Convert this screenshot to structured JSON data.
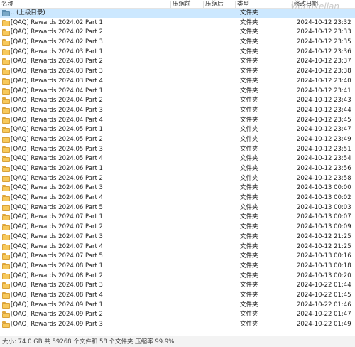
{
  "watermark": "wongkellan",
  "columns": {
    "name": "名称",
    "packed": "压缩前",
    "compressed": "压缩后",
    "type": "类型",
    "modified": "修改日期"
  },
  "parent_row": {
    "name": ".. (上级目录)",
    "type": "文件夹",
    "icon": "folder-up-icon"
  },
  "rows": [
    {
      "name": "[QAQ] Rewards 2024.02 Part 1",
      "type": "文件夹",
      "date": "2024-10-12 23:32",
      "icon": "folder-icon"
    },
    {
      "name": "[QAQ] Rewards 2024.02 Part 2",
      "type": "文件夹",
      "date": "2024-10-12 23:33",
      "icon": "folder-icon"
    },
    {
      "name": "[QAQ] Rewards 2024.02 Part 3",
      "type": "文件夹",
      "date": "2024-10-12 23:35",
      "icon": "folder-icon"
    },
    {
      "name": "[QAQ] Rewards 2024.03 Part 1",
      "type": "文件夹",
      "date": "2024-10-12 23:36",
      "icon": "folder-icon"
    },
    {
      "name": "[QAQ] Rewards 2024.03 Part 2",
      "type": "文件夹",
      "date": "2024-10-12 23:37",
      "icon": "folder-icon"
    },
    {
      "name": "[QAQ] Rewards 2024.03 Part 3",
      "type": "文件夹",
      "date": "2024-10-12 23:38",
      "icon": "folder-icon"
    },
    {
      "name": "[QAQ] Rewards 2024.03 Part 4",
      "type": "文件夹",
      "date": "2024-10-12 23:40",
      "icon": "folder-icon"
    },
    {
      "name": "[QAQ] Rewards 2024.04 Part 1",
      "type": "文件夹",
      "date": "2024-10-12 23:41",
      "icon": "folder-icon"
    },
    {
      "name": "[QAQ] Rewards 2024.04 Part 2",
      "type": "文件夹",
      "date": "2024-10-12 23:43",
      "icon": "folder-icon"
    },
    {
      "name": "[QAQ] Rewards 2024.04 Part 3",
      "type": "文件夹",
      "date": "2024-10-12 23:44",
      "icon": "folder-icon"
    },
    {
      "name": "[QAQ] Rewards 2024.04 Part 4",
      "type": "文件夹",
      "date": "2024-10-12 23:45",
      "icon": "folder-icon"
    },
    {
      "name": "[QAQ] Rewards 2024.05 Part 1",
      "type": "文件夹",
      "date": "2024-10-12 23:47",
      "icon": "folder-icon"
    },
    {
      "name": "[QAQ] Rewards 2024.05 Part 2",
      "type": "文件夹",
      "date": "2024-10-12 23:49",
      "icon": "folder-icon"
    },
    {
      "name": "[QAQ] Rewards 2024.05 Part 3",
      "type": "文件夹",
      "date": "2024-10-12 23:51",
      "icon": "folder-icon"
    },
    {
      "name": "[QAQ] Rewards 2024.05 Part 4",
      "type": "文件夹",
      "date": "2024-10-12 23:54",
      "icon": "folder-icon"
    },
    {
      "name": "[QAQ] Rewards 2024.06 Part 1",
      "type": "文件夹",
      "date": "2024-10-12 23:56",
      "icon": "folder-icon"
    },
    {
      "name": "[QAQ] Rewards 2024.06 Part 2",
      "type": "文件夹",
      "date": "2024-10-12 23:58",
      "icon": "folder-icon"
    },
    {
      "name": "[QAQ] Rewards 2024.06 Part 3",
      "type": "文件夹",
      "date": "2024-10-13 00:00",
      "icon": "folder-icon"
    },
    {
      "name": "[QAQ] Rewards 2024.06 Part 4",
      "type": "文件夹",
      "date": "2024-10-13 00:02",
      "icon": "folder-icon"
    },
    {
      "name": "[QAQ] Rewards 2024.06 Part 5",
      "type": "文件夹",
      "date": "2024-10-13 00:03",
      "icon": "folder-icon"
    },
    {
      "name": "[QAQ] Rewards 2024.07 Part 1",
      "type": "文件夹",
      "date": "2024-10-13 00:07",
      "icon": "folder-icon"
    },
    {
      "name": "[QAQ] Rewards 2024.07 Part 2",
      "type": "文件夹",
      "date": "2024-10-13 00:09",
      "icon": "folder-icon"
    },
    {
      "name": "[QAQ] Rewards 2024.07 Part 3",
      "type": "文件夹",
      "date": "2024-10-12 21:25",
      "icon": "folder-icon"
    },
    {
      "name": "[QAQ] Rewards 2024.07 Part 4",
      "type": "文件夹",
      "date": "2024-10-12 21:25",
      "icon": "folder-icon"
    },
    {
      "name": "[QAQ] Rewards 2024.07 Part 5",
      "type": "文件夹",
      "date": "2024-10-13 00:16",
      "icon": "folder-icon"
    },
    {
      "name": "[QAQ] Rewards 2024.08 Part 1",
      "type": "文件夹",
      "date": "2024-10-13 00:18",
      "icon": "folder-icon"
    },
    {
      "name": "[QAQ] Rewards 2024.08 Part 2",
      "type": "文件夹",
      "date": "2024-10-13 00:20",
      "icon": "folder-icon"
    },
    {
      "name": "[QAQ] Rewards 2024.08 Part 3",
      "type": "文件夹",
      "date": "2024-10-22 01:44",
      "icon": "folder-icon"
    },
    {
      "name": "[QAQ] Rewards 2024.08 Part 4",
      "type": "文件夹",
      "date": "2024-10-22 01:45",
      "icon": "folder-icon"
    },
    {
      "name": "[QAQ] Rewards 2024.09 Part 1",
      "type": "文件夹",
      "date": "2024-10-22 01:46",
      "icon": "folder-icon"
    },
    {
      "name": "[QAQ] Rewards 2024.09 Part 2",
      "type": "文件夹",
      "date": "2024-10-22 01:47",
      "icon": "folder-icon"
    },
    {
      "name": "[QAQ] Rewards 2024.09 Part 3",
      "type": "文件夹",
      "date": "2024-10-22 01:49",
      "icon": "folder-icon"
    }
  ],
  "status": "大小: 74.0 GB 共 59268 个文件和 58 个文件夹 压缩率 99.9%",
  "colors": {
    "selection": "#cce8ff",
    "folder": "#f7c95c",
    "folder_border": "#d9a23a"
  }
}
